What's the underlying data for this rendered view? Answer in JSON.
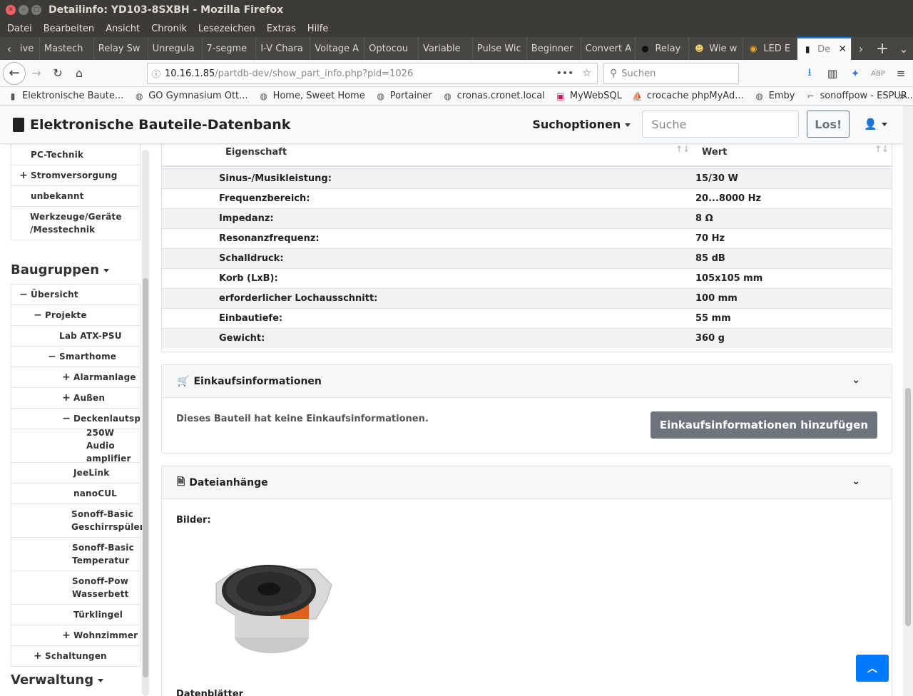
{
  "window": {
    "title": "Detailinfo: YD103-8SXBH - Mozilla Firefox"
  },
  "menu": [
    "Datei",
    "Bearbeiten",
    "Ansicht",
    "Chronik",
    "Lesezeichen",
    "Extras",
    "Hilfe"
  ],
  "tabs": [
    {
      "label": "ive",
      "icon": "page-icon"
    },
    {
      "label": "Mastech",
      "icon": "page-icon"
    },
    {
      "label": "Relay Sw",
      "icon": "page-icon"
    },
    {
      "label": "Unregula",
      "icon": "page-icon"
    },
    {
      "label": "7-segme",
      "icon": "page-icon"
    },
    {
      "label": "I-V Chara",
      "icon": "page-icon"
    },
    {
      "label": "Voltage A",
      "icon": "page-icon"
    },
    {
      "label": "Optocou",
      "icon": "page-icon"
    },
    {
      "label": "Variable",
      "icon": "page-icon"
    },
    {
      "label": "Pulse Wic",
      "icon": "page-icon"
    },
    {
      "label": "Beginner",
      "icon": "page-icon"
    },
    {
      "label": "Convert A",
      "icon": "page-icon"
    },
    {
      "label": "Relay",
      "icon": "page-icon"
    },
    {
      "label": "Wie w",
      "icon": "page-icon"
    },
    {
      "label": "LED E",
      "icon": "page-icon"
    },
    {
      "label": "De",
      "icon": "chip-icon",
      "active": true
    }
  ],
  "nav": {
    "url_host": "10.16.1.85",
    "url_path": "/partdb-dev/show_part_info.php?pid=1026",
    "search_placeholder": "Suchen"
  },
  "bookmarks": [
    "Elektronische Baute...",
    "GO Gymnasium Ott...",
    "Home, Sweet Home",
    "Portainer",
    "cronas.cronet.local",
    "MyWebSQL",
    "crocache phpMyAd...",
    "Emby",
    "sonoffpow - ESPUR..."
  ],
  "app": {
    "brand": "Elektronische Bauteile-Datenbank",
    "suchoptionen": "Suchoptionen",
    "search_placeholder": "Suche",
    "search_button": "Los!"
  },
  "sidebar": {
    "top_items": [
      {
        "label": "PC-Technik",
        "prefix": ""
      },
      {
        "label": "Stromversorgung",
        "prefix": "+"
      },
      {
        "label": "unbekannt",
        "prefix": ""
      },
      {
        "label": "Werkzeuge/Geräte /Messtechnik",
        "prefix": ""
      }
    ],
    "baugruppen_title": "Baugruppen",
    "tree": [
      {
        "label": "Übersicht",
        "prefix": "−"
      },
      {
        "label": "Projekte",
        "prefix": "−"
      },
      {
        "label": "Lab ATX-PSU",
        "prefix": ""
      },
      {
        "label": "Smarthome",
        "prefix": "−"
      },
      {
        "label": "Alarmanlage",
        "prefix": "+"
      },
      {
        "label": "Außen",
        "prefix": "+"
      },
      {
        "label": "Deckenlautspre",
        "prefix": "−"
      },
      {
        "label": "250W Audio amplifier",
        "prefix": ""
      },
      {
        "label": "JeeLink",
        "prefix": ""
      },
      {
        "label": "nanoCUL",
        "prefix": ""
      },
      {
        "label": "Sonoff-Basic Geschirrspüler",
        "prefix": ""
      },
      {
        "label": "Sonoff-Basic Temperatur",
        "prefix": ""
      },
      {
        "label": "Sonoff-Pow Wasserbett",
        "prefix": ""
      },
      {
        "label": "Türklingel",
        "prefix": ""
      },
      {
        "label": "Wohnzimmer",
        "prefix": "+"
      },
      {
        "label": "Schaltungen",
        "prefix": "+"
      }
    ],
    "verwaltung_title": "Verwaltung"
  },
  "properties": {
    "col_property": "Eigenschaft",
    "col_value": "Wert",
    "rows": [
      {
        "name": "Sinus-/Musikleistung:",
        "value": "15/30 W"
      },
      {
        "name": "Frequenzbereich:",
        "value": "20...8000 Hz"
      },
      {
        "name": "Impedanz:",
        "value": "8 Ω"
      },
      {
        "name": "Resonanzfrequenz:",
        "value": "70 Hz"
      },
      {
        "name": "Schalldruck:",
        "value": "85 dB"
      },
      {
        "name": "Korb (LxB):",
        "value": "105x105 mm"
      },
      {
        "name": "erforderlicher Lochausschnitt:",
        "value": "100 mm"
      },
      {
        "name": "Einbautiefe:",
        "value": "55 mm"
      },
      {
        "name": "Gewicht:",
        "value": "360 g"
      }
    ]
  },
  "einkauf": {
    "title": "Einkaufsinformationen",
    "note": "Dieses Bauteil hat keine Einkaufsinformationen.",
    "add_button": "Einkaufsinformationen hinzufügen"
  },
  "anhaenge": {
    "title": "Dateianhänge",
    "bilder_label": "Bilder:",
    "datenblaetter_label": "Datenblätter"
  }
}
